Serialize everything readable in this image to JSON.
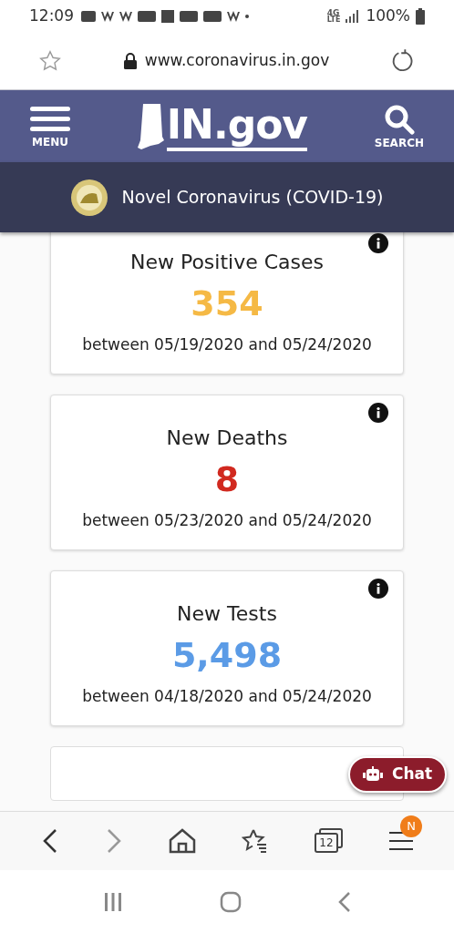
{
  "status_bar": {
    "time": "12:09",
    "network": "4G",
    "network_sub": "LTE",
    "battery": "100%"
  },
  "address_bar": {
    "url": "www.coronavirus.in.gov"
  },
  "header": {
    "menu_label": "MENU",
    "logo": "IN.gov",
    "search_label": "SEARCH"
  },
  "subheader": {
    "title": "Novel Coronavirus (COVID-19)"
  },
  "cards": [
    {
      "title": "New Positive Cases",
      "value": "354",
      "color": "#f5b945",
      "range": "between 05/19/2020 and 05/24/2020"
    },
    {
      "title": "New Deaths",
      "value": "8",
      "color": "#d1291f",
      "range": "between 05/23/2020 and 05/24/2020"
    },
    {
      "title": "New Tests",
      "value": "5,498",
      "color": "#5b9be6",
      "range": "between 04/18/2020 and 05/24/2020"
    }
  ],
  "chat": {
    "label": "Chat"
  },
  "browser_bar": {
    "tabs_count": "12",
    "menu_badge": "N"
  }
}
